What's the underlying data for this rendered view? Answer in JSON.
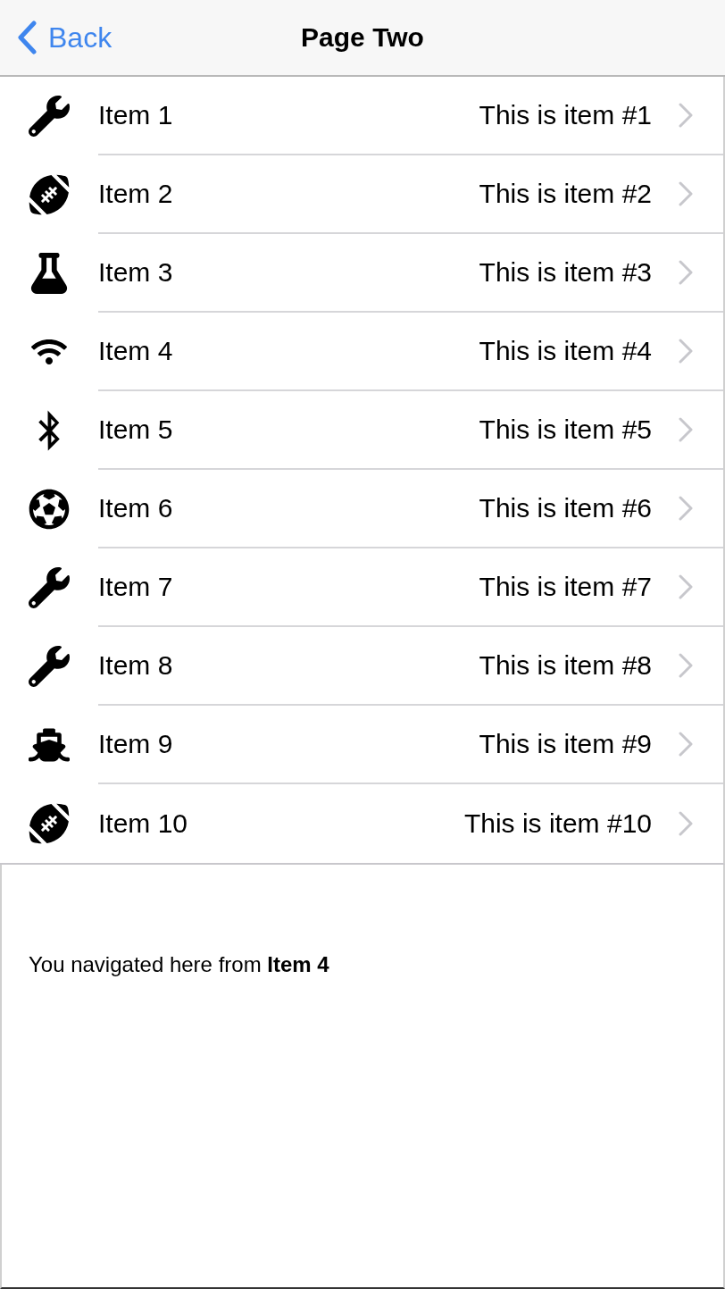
{
  "nav_bar": {
    "back_button": "Back",
    "title": "Page Two"
  },
  "items": [
    {
      "kind": "wrench",
      "title": "Item 1",
      "detail": "This is item #1"
    },
    {
      "kind": "football",
      "title": "Item 2",
      "detail": "This is item #2"
    },
    {
      "kind": "flask",
      "title": "Item 3",
      "detail": "This is item #3"
    },
    {
      "kind": "wifi",
      "title": "Item 4",
      "detail": "This is item #4"
    },
    {
      "kind": "bluetooth",
      "title": "Item 5",
      "detail": "This is item #5"
    },
    {
      "kind": "soccer",
      "title": "Item 6",
      "detail": "This is item #6"
    },
    {
      "kind": "wrench",
      "title": "Item 7",
      "detail": "This is item #7"
    },
    {
      "kind": "wrench",
      "title": "Item 8",
      "detail": "This is item #8"
    },
    {
      "kind": "ship",
      "title": "Item 9",
      "detail": "This is item #9"
    },
    {
      "kind": "football",
      "title": "Item 10",
      "detail": "This is item #10"
    }
  ],
  "footer": {
    "message": "You navigated here from **Item 4**"
  }
}
